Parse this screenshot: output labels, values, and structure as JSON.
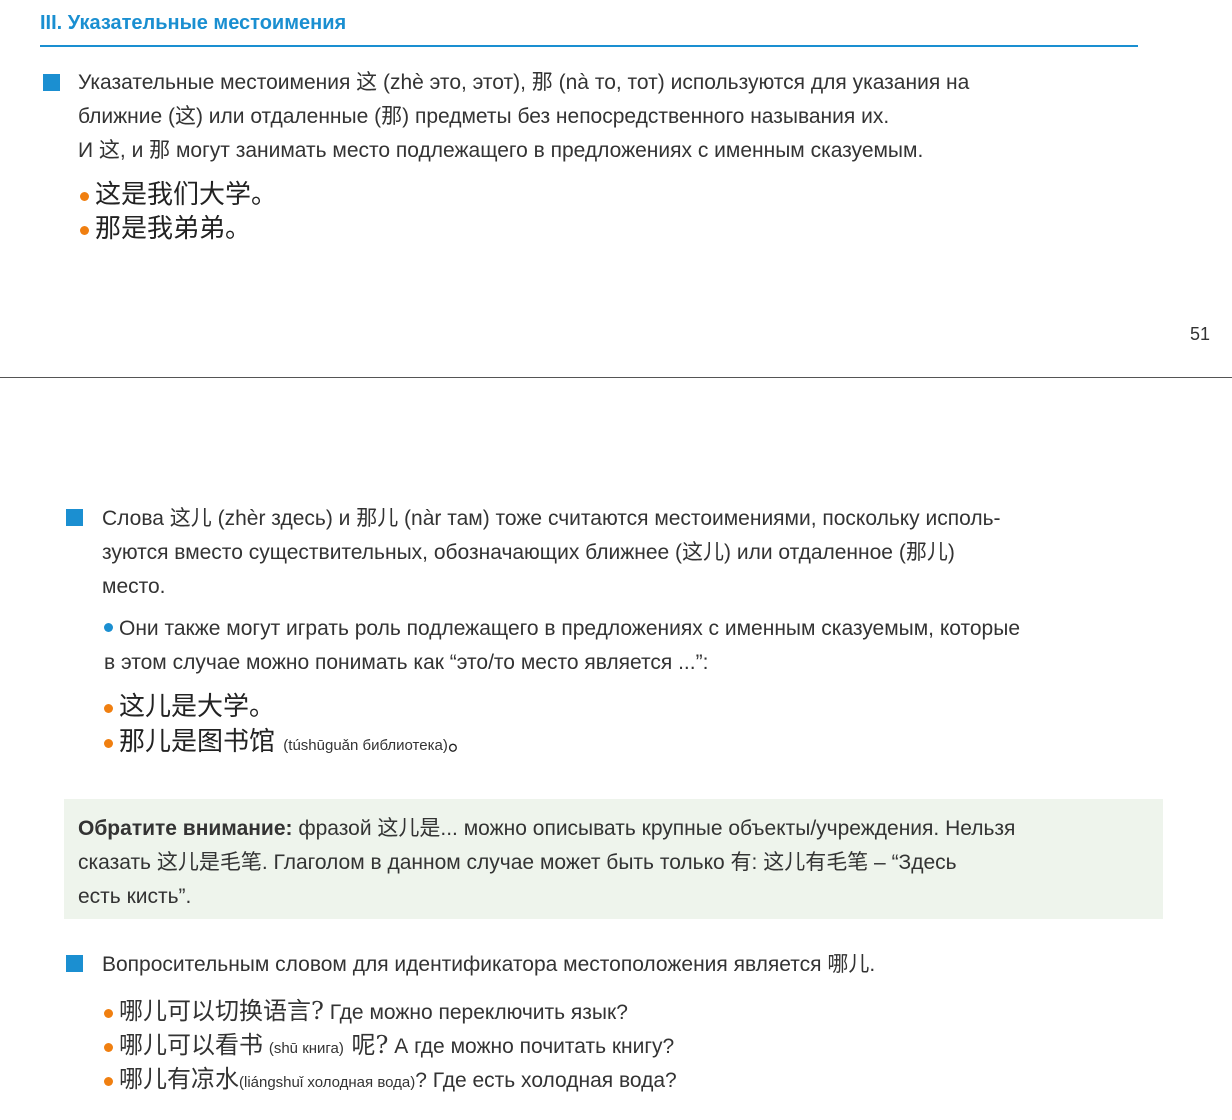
{
  "section_title": "III. Указательные местоимения",
  "page_number": "51",
  "block1": {
    "line1": "Указательные местоимения 这 (zhè это, этот), 那 (nà то, тот) используются для указания на",
    "line2": "ближние (这) или отдаленные (那) предметы без непосредственного называния их.",
    "line3": "И 这, и 那 могут занимать место подлежащего в предложениях с именным сказуемым.",
    "examples": [
      "这是我们大学。",
      "那是我弟弟。"
    ]
  },
  "block2": {
    "line1": "Слова 这儿 (zhèr здесь) и 那儿 (nàr там) тоже считаются местоимениями, поскольку исполь-",
    "line2": "зуются вместо существительных, обозначающих ближнее (这儿) или отдаленное (那儿)",
    "line3": "место.",
    "sub_line1": "Они также могут играть роль подлежащего в предложениях с именным сказуемым, которые",
    "sub_line2": "в этом случае можно понимать как “это/то место является ...”:",
    "example1": "这儿是大学。",
    "example2_cn": "那儿是图书馆",
    "example2_note": "(túshūguǎn библиотека)",
    "example2_end": "。"
  },
  "note": {
    "label": "Обратите внимание:",
    "line1_rest": " фразой 这儿是... можно описывать крупные объекты/учреждения. Нельзя",
    "line2": "сказать 这儿是毛笔. Глаголом в данном случае может быть только 有: 这儿有毛笔 – “Здесь",
    "line3": "есть кисть”."
  },
  "block3": {
    "line1": "Вопросительным словом для идентификатора местоположения является 哪儿.",
    "q1_cn": "哪儿可以切换语言?",
    "q1_ru": " Где можно переключить язык?",
    "q2_cn": "哪儿可以看书",
    "q2_note": "(shū книга)",
    "q2_cn2": " 呢?",
    "q2_ru": " А где можно почитать книгу?",
    "q3_cn": "哪儿有凉水",
    "q3_note": "(liángshuǐ холодная вода)",
    "q3_ru": "? Где есть холодная вода?"
  },
  "colors": {
    "accent": "#1a8fd1",
    "bullet": "#f07f10",
    "note_bg": "#eef4ec"
  }
}
